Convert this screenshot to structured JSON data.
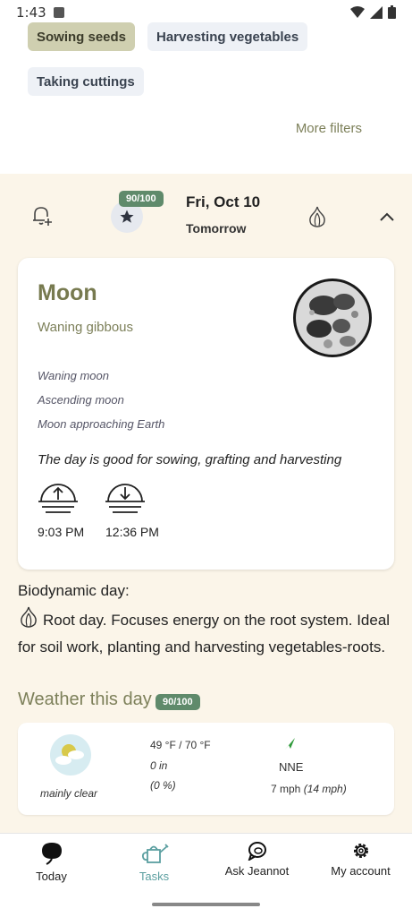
{
  "status_bar": {
    "time": "1:43"
  },
  "filters": {
    "chips": [
      {
        "label": "Sowing seeds",
        "selected": true
      },
      {
        "label": "Harvesting vegetables",
        "selected": false
      },
      {
        "label": "Taking cuttings",
        "selected": false
      }
    ],
    "more_filters": "More filters"
  },
  "day_header": {
    "score": "90/100",
    "date": "Fri, Oct 10",
    "relative": "Tomorrow"
  },
  "moon": {
    "title": "Moon",
    "phase": "Waning gibbous",
    "details": [
      "Waning moon",
      "Ascending moon",
      "Moon approaching Earth"
    ],
    "summary": "The day is good for sowing, grafting and harvesting",
    "moonrise": "9:03 PM",
    "moonset": "12:36 PM"
  },
  "biodynamic": {
    "label": "Biodynamic day:",
    "text": "Root day. Focuses energy on the root system. Ideal for soil work, planting and harvesting vegetables-roots."
  },
  "weather": {
    "title": "Weather this day",
    "score": "90/100",
    "condition": "mainly clear",
    "temps": "49 °F / 70 °F",
    "precip": "0 in",
    "precip_pct": "(0 %)",
    "wind_dir": "NNE",
    "wind_speed": "7 mph",
    "wind_gust": "(14 mph)"
  },
  "nav": {
    "items": [
      {
        "label": "Today",
        "icon": "leaf-icon",
        "active": false
      },
      {
        "label": "Tasks",
        "icon": "watering-can-icon",
        "active": true
      },
      {
        "label": "Ask Jeannot",
        "icon": "chat-icon",
        "active": false
      },
      {
        "label": "My account",
        "icon": "gear-icon",
        "active": false
      }
    ]
  },
  "colors": {
    "accent_olive": "#7d805a",
    "badge_green": "#5f8a6b",
    "panel_bg": "#fbf5e9",
    "active_tab": "#5b9fa0"
  }
}
